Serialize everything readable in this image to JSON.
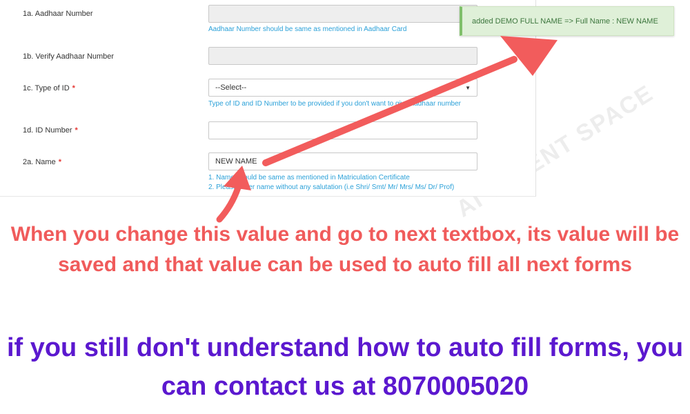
{
  "form": {
    "aadhaar_number": {
      "label": "1a. Aadhaar Number",
      "value": "",
      "help": "Aadhaar Number should be same as mentioned in Aadhaar Card"
    },
    "verify_aadhaar": {
      "label": "1b. Verify Aadhaar Number",
      "value": ""
    },
    "id_type": {
      "label": "1c. Type of ID",
      "required_mark": "*",
      "selected": "--Select--",
      "help": "Type of ID and ID Number to be provided if you don't want to give Aadhaar number"
    },
    "id_number": {
      "label": "1d. ID Number",
      "required_mark": "*",
      "value": ""
    },
    "name": {
      "label": "2a. Name",
      "required_mark": "*",
      "value": "NEW NAME",
      "help_1": "1. Name should be same as mentioned in Matriculation Certificate",
      "help_2": "2. Please enter name without any salutation (i.e Shri/ Smt/ Mr/ Mrs/ Ms/ Dr/ Prof)"
    }
  },
  "toast": {
    "message": "added DEMO FULL NAME => Full Name : NEW NAME"
  },
  "captions": {
    "instruction": "When you change this value and go to next textbox, its value will be saved and that value can be used to auto fill all next forms",
    "contact": "if you still don't understand how to auto fill forms, you can contact us at 8070005020"
  },
  "colors": {
    "arrow": "#f25c5c",
    "instruction_text": "#f05b5b",
    "contact_text": "#5b18cf",
    "help_text": "#2aa0d8",
    "toast_bg": "#dff0d8"
  },
  "watermark": "AI TALENT SPACE"
}
